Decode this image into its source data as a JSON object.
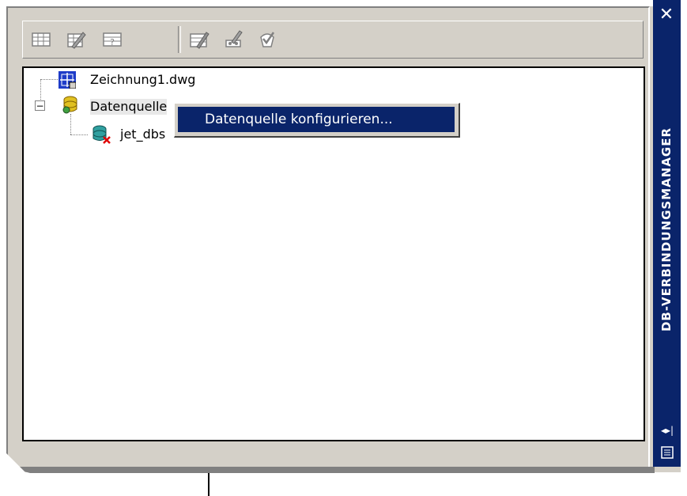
{
  "toolbar": {
    "buttons": [
      {
        "name": "view-table-icon"
      },
      {
        "name": "edit-table-icon"
      },
      {
        "name": "query-icon"
      },
      {
        "name": "link-template-icon"
      },
      {
        "name": "label-template-icon"
      },
      {
        "name": "synchronize-icon"
      }
    ]
  },
  "tree": {
    "drawing": {
      "label": "Zeichnung1.dwg"
    },
    "datasources": {
      "label": "Datenquelle",
      "expander": "−"
    },
    "connection": {
      "label": "jet_dbs"
    }
  },
  "context_menu": {
    "items": [
      {
        "label": "Datenquelle konfigurieren..."
      }
    ]
  },
  "titlebar": {
    "title": "DB-VERBINDUNGSMANAGER",
    "close_glyph": "✕",
    "autohide_glyph": "◂▸|"
  },
  "colors": {
    "titlebar": "#0a246a",
    "panel": "#d4d0c8",
    "highlight": "#0a246a"
  }
}
